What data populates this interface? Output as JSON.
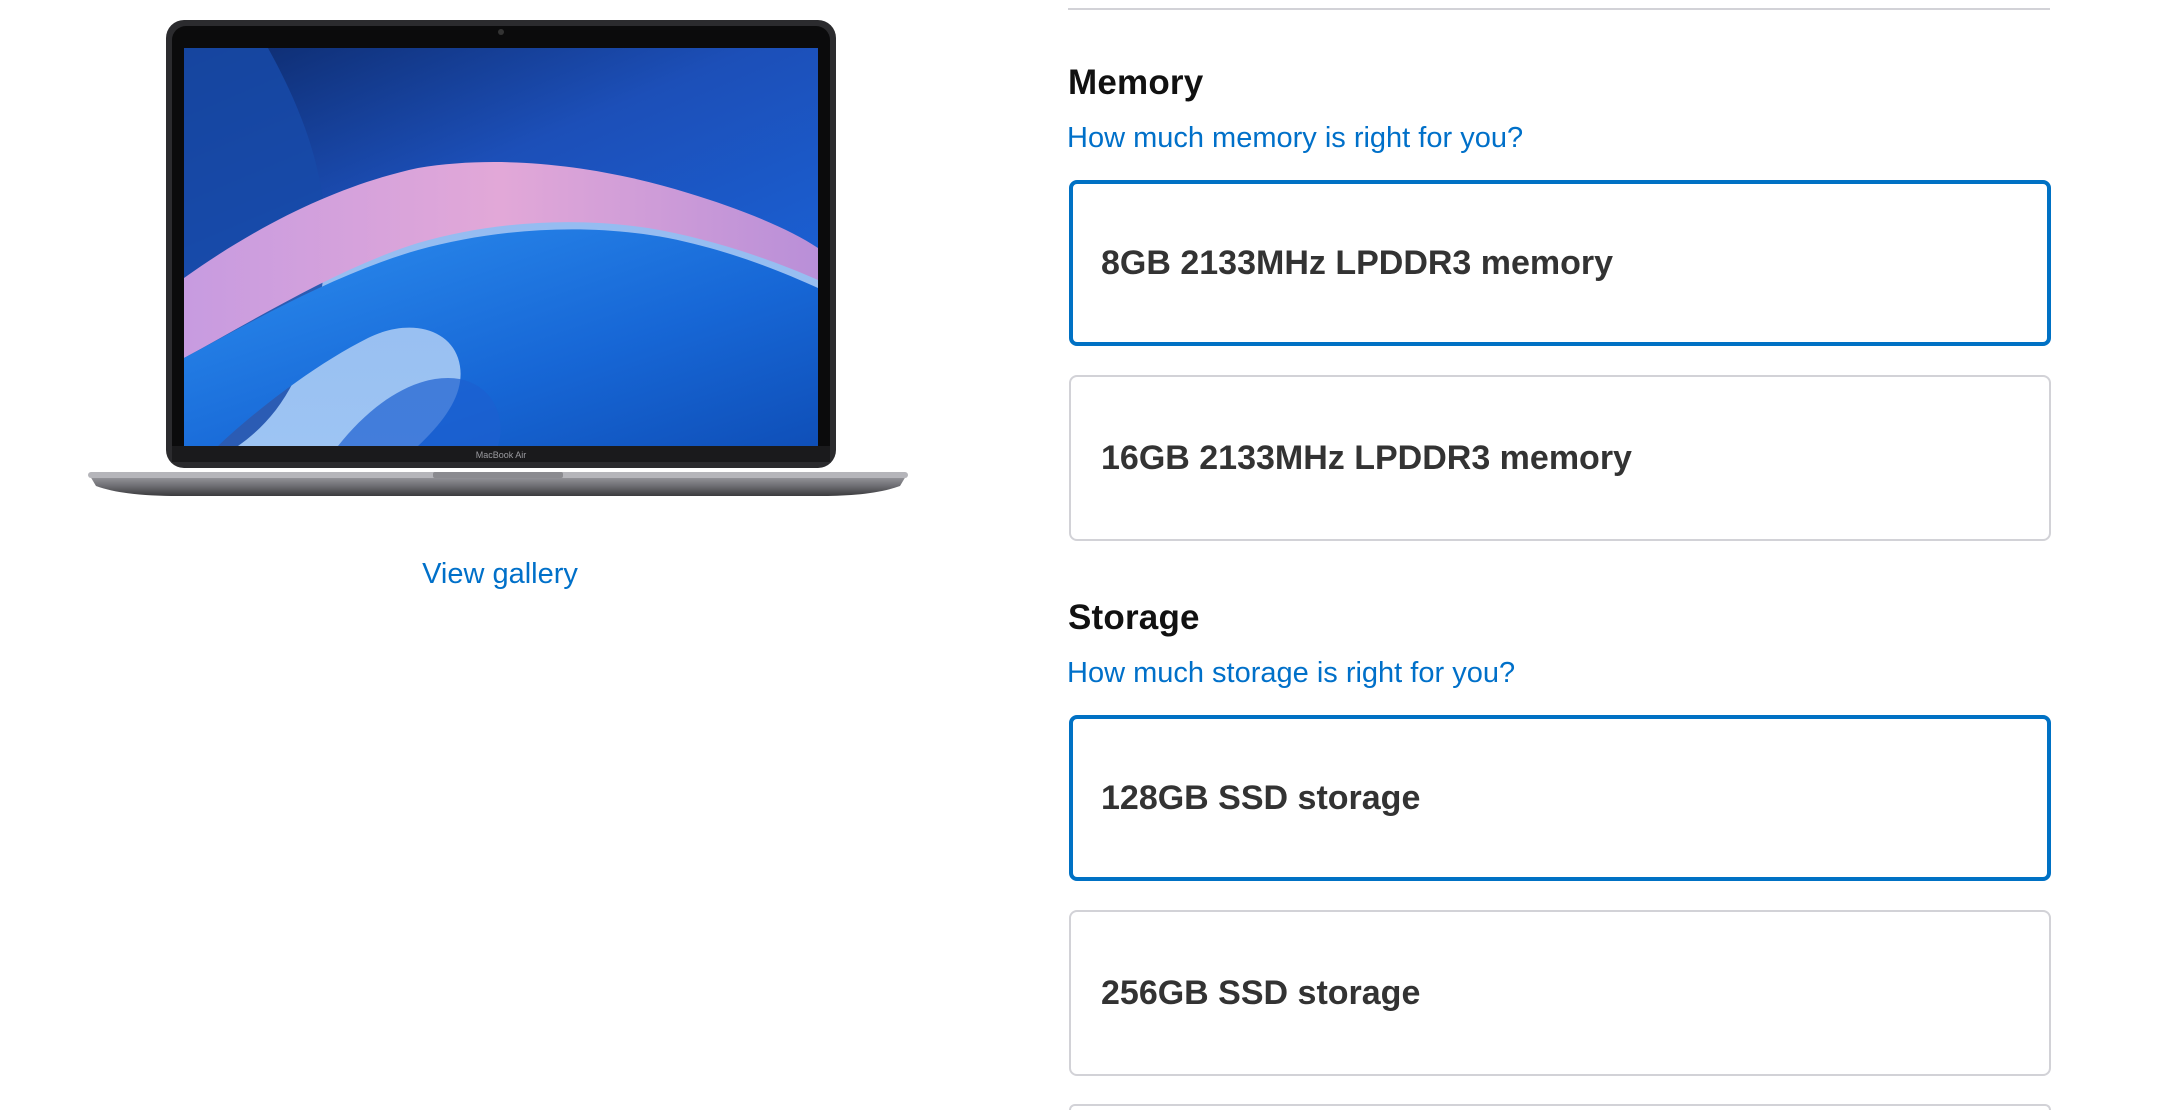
{
  "gallery": {
    "view_gallery_label": "View gallery",
    "laptop_logo_text": "MacBook Air"
  },
  "memory": {
    "title": "Memory",
    "help_link": "How much memory is right for you?",
    "options": [
      {
        "label": "8GB 2133MHz LPDDR3 memory",
        "selected": true
      },
      {
        "label": "16GB 2133MHz LPDDR3 memory",
        "selected": false
      }
    ]
  },
  "storage": {
    "title": "Storage",
    "help_link": "How much storage is right for you?",
    "options": [
      {
        "label": "128GB SSD storage",
        "selected": true
      },
      {
        "label": "256GB SSD storage",
        "selected": false
      }
    ]
  },
  "colors": {
    "accent": "#0071c4",
    "link": "#0070c9",
    "border": "#d2d2d7"
  }
}
